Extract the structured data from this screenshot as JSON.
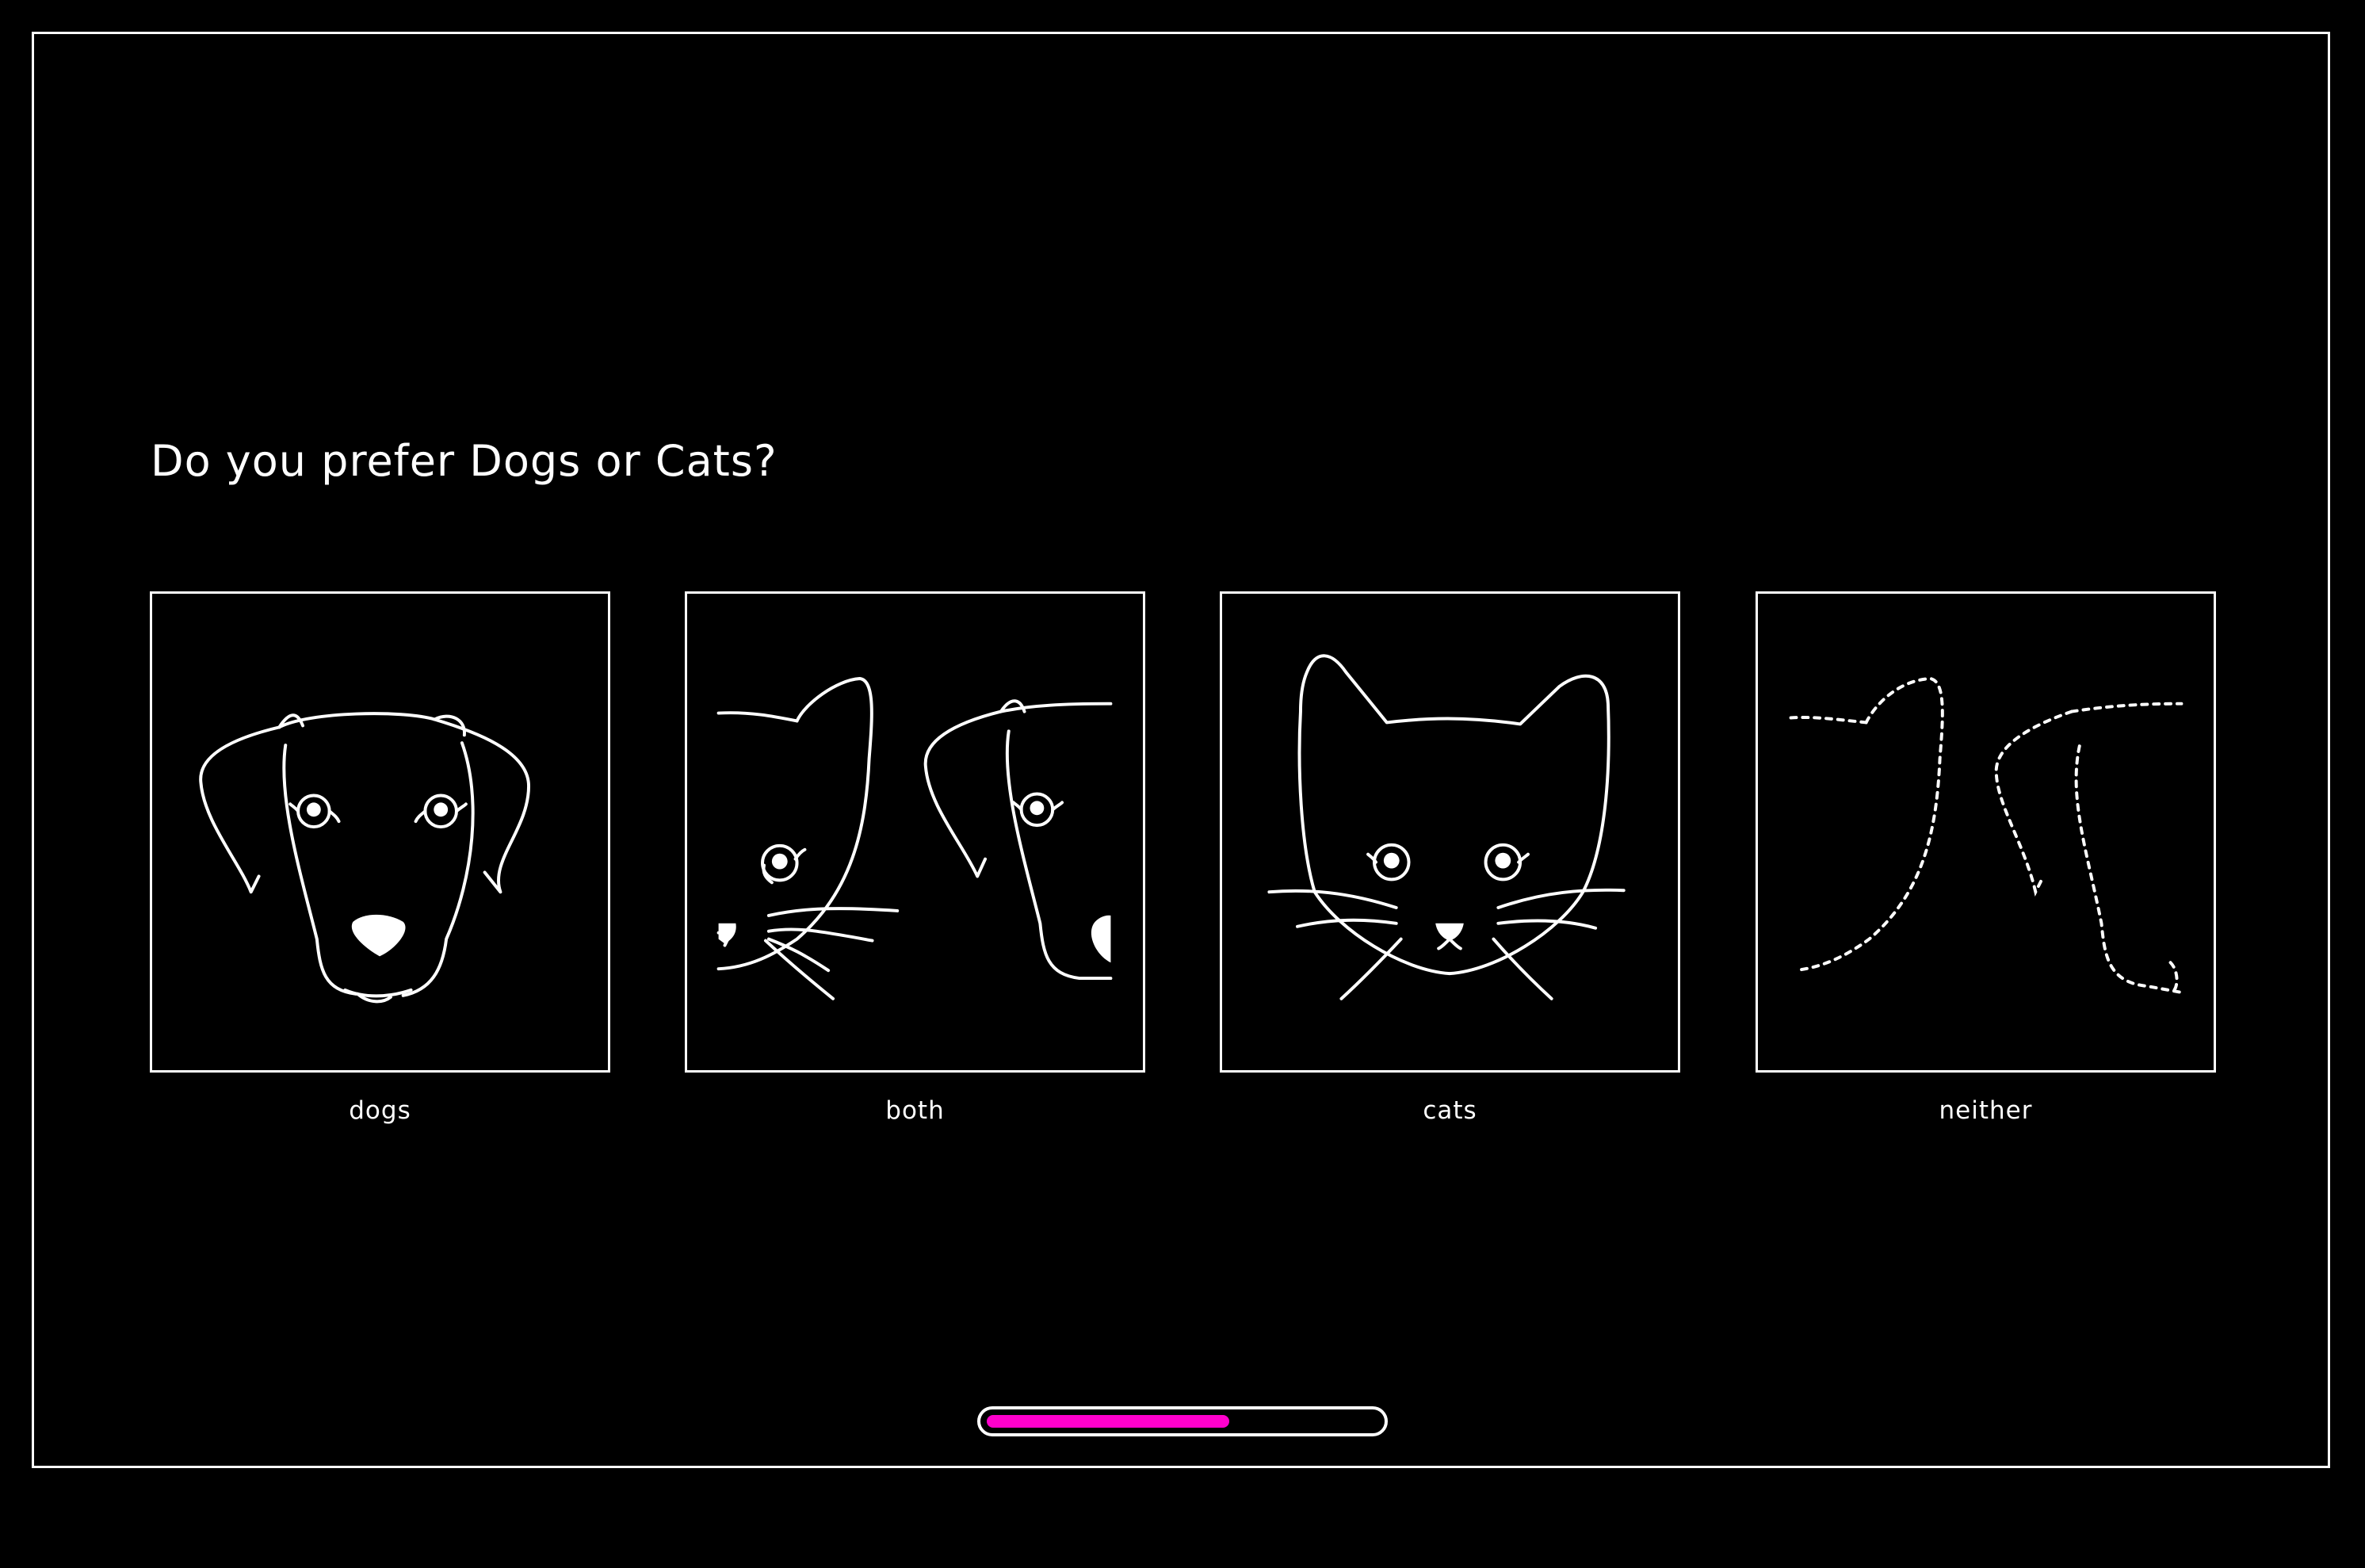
{
  "question": "Do you prefer Dogs or Cats?",
  "options": [
    {
      "label": "dogs",
      "icon": "dog-face-icon"
    },
    {
      "label": "both",
      "icon": "cat-and-dog-split-icon"
    },
    {
      "label": "cats",
      "icon": "cat-face-icon"
    },
    {
      "label": "neither",
      "icon": "dotted-outline-icon"
    }
  ],
  "progress": {
    "fraction": 0.62,
    "fill_color": "#ff00cc",
    "track_border_color": "#ffffff"
  },
  "colors": {
    "background": "#000000",
    "foreground": "#ffffff"
  }
}
